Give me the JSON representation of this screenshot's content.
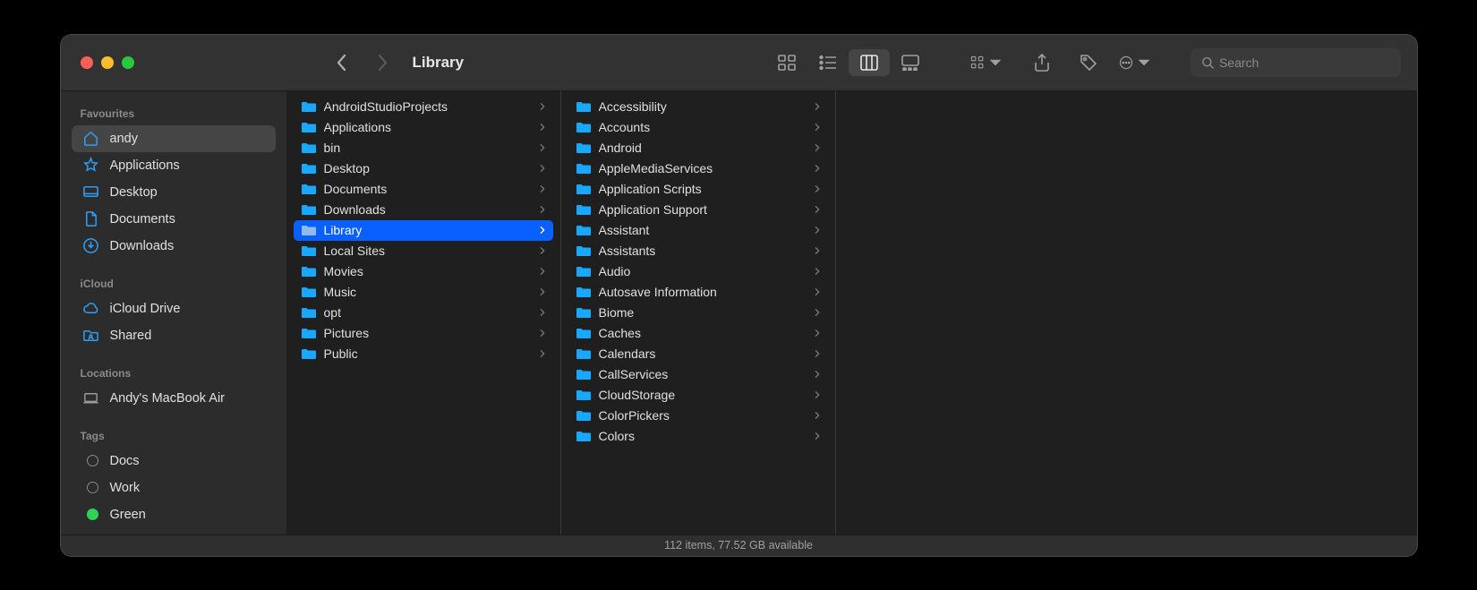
{
  "title": "Library",
  "search": {
    "placeholder": "Search"
  },
  "sidebar": {
    "sections": [
      {
        "heading": "Favourites",
        "items": [
          {
            "label": "andy",
            "icon": "home",
            "active": true
          },
          {
            "label": "Applications",
            "icon": "applications"
          },
          {
            "label": "Desktop",
            "icon": "desktop"
          },
          {
            "label": "Documents",
            "icon": "documents"
          },
          {
            "label": "Downloads",
            "icon": "downloads"
          }
        ]
      },
      {
        "heading": "iCloud",
        "items": [
          {
            "label": "iCloud Drive",
            "icon": "cloud"
          },
          {
            "label": "Shared",
            "icon": "shared-folder"
          }
        ]
      },
      {
        "heading": "Locations",
        "items": [
          {
            "label": "Andy's MacBook Air",
            "icon": "laptop"
          }
        ]
      },
      {
        "heading": "Tags",
        "items": [
          {
            "label": "Docs",
            "icon": "tag-circle"
          },
          {
            "label": "Work",
            "icon": "tag-circle"
          },
          {
            "label": "Green",
            "icon": "tag-green"
          }
        ]
      }
    ]
  },
  "columns": [
    {
      "items": [
        {
          "label": "AndroidStudioProjects"
        },
        {
          "label": "Applications"
        },
        {
          "label": "bin"
        },
        {
          "label": "Desktop"
        },
        {
          "label": "Documents"
        },
        {
          "label": "Downloads"
        },
        {
          "label": "Library",
          "selected": true,
          "dimmed": true
        },
        {
          "label": "Local Sites"
        },
        {
          "label": "Movies"
        },
        {
          "label": "Music"
        },
        {
          "label": "opt"
        },
        {
          "label": "Pictures"
        },
        {
          "label": "Public"
        }
      ]
    },
    {
      "items": [
        {
          "label": "Accessibility"
        },
        {
          "label": "Accounts"
        },
        {
          "label": "Android"
        },
        {
          "label": "AppleMediaServices"
        },
        {
          "label": "Application Scripts"
        },
        {
          "label": "Application Support"
        },
        {
          "label": "Assistant"
        },
        {
          "label": "Assistants"
        },
        {
          "label": "Audio"
        },
        {
          "label": "Autosave Information"
        },
        {
          "label": "Biome"
        },
        {
          "label": "Caches"
        },
        {
          "label": "Calendars"
        },
        {
          "label": "CallServices"
        },
        {
          "label": "CloudStorage"
        },
        {
          "label": "ColorPickers"
        },
        {
          "label": "Colors"
        }
      ]
    }
  ],
  "status": "112 items, 77.52 GB available",
  "colors": {
    "accent": "#0a5fff",
    "sidebar_icon": "#2f9df5",
    "folder": "#19a8ff"
  }
}
